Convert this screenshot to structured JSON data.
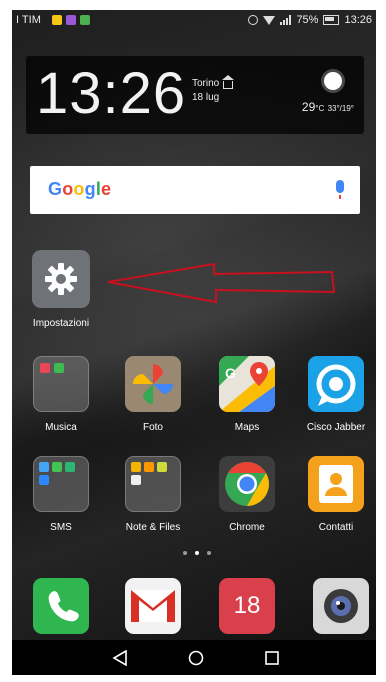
{
  "status_bar": {
    "carrier": "I TIM",
    "battery": "75%",
    "time": "13:26"
  },
  "clock_widget": {
    "time": "13:26",
    "city": "Torino",
    "date": "18 lug",
    "temperature": "29",
    "temperature_unit": "°C",
    "range": "33°/19°"
  },
  "search": {
    "logo": "Google"
  },
  "arrow_annotation": {
    "color": "#c8101e"
  },
  "apps": {
    "settings": "Impostazioni",
    "row1": [
      "Musica",
      "Foto",
      "Maps",
      "Cisco Jabber"
    ],
    "row2": [
      "SMS",
      "Note & Files",
      "Chrome",
      "Contatti"
    ]
  },
  "dock": {
    "calendar_day": "18"
  },
  "page_indicator": {
    "pages": 3,
    "active": 2
  },
  "icons": [
    "alarm-icon",
    "wifi-icon",
    "signal-icon",
    "battery-icon",
    "home-icon",
    "sun-icon",
    "mic-icon",
    "gear-icon",
    "phone-icon",
    "gmail-icon",
    "calendar-icon",
    "camera-icon",
    "back-icon",
    "home-nav-icon",
    "recents-icon"
  ]
}
